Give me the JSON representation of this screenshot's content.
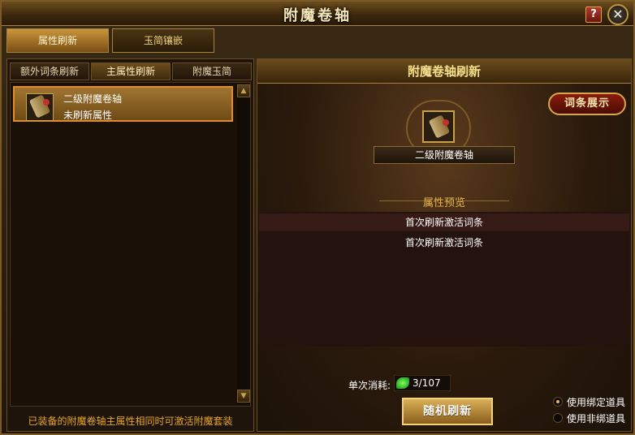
{
  "window": {
    "title": "附魔卷轴",
    "help_label": "?",
    "close_label": "✕"
  },
  "top_tabs": [
    {
      "label": "属性刷新",
      "active": true
    },
    {
      "label": "玉简镶嵌",
      "active": false
    }
  ],
  "left_panel": {
    "sub_tabs": [
      {
        "label": "额外词条刷新"
      },
      {
        "label": "主属性刷新",
        "active": true
      },
      {
        "label": "附魔玉简"
      }
    ],
    "items": [
      {
        "name": "二级附魔卷轴",
        "status": "未刷新属性",
        "icon": "scroll-icon",
        "selected": true
      }
    ],
    "footer": "已装备的附魔卷轴主属性相同时可激活附魔套装"
  },
  "right_panel": {
    "header": "附魔卷轴刷新",
    "entry_button": "词条展示",
    "selected_scroll_name": "二级附魔卷轴",
    "preview_title": "属性预览",
    "attributes": [
      "首次刷新激活词条",
      "首次刷新激活词条"
    ],
    "cost_label": "单次消耗:",
    "cost_value": "3/107",
    "cost_icon": "green-jade-icon",
    "refresh_button": "随机刷新",
    "options": [
      {
        "label": "使用绑定道具",
        "selected": true
      },
      {
        "label": "使用非绑道具",
        "selected": false
      }
    ]
  },
  "colors": {
    "accent_gold": "#e8b84a",
    "footer_orange": "#e7a52a",
    "selection_border": "#e38b2c",
    "title_gold": "#f7e08a"
  }
}
